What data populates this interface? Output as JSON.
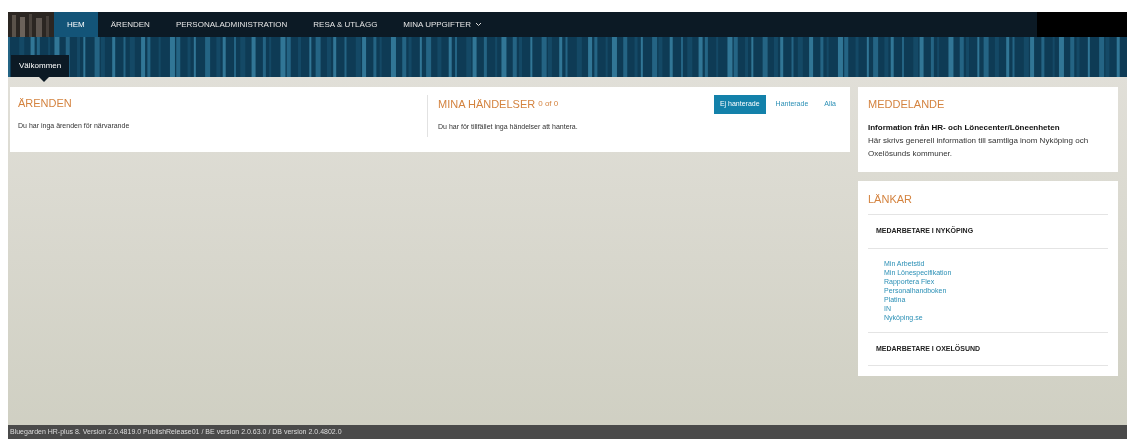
{
  "nav": {
    "items": [
      {
        "label": "HEM",
        "selected": true,
        "dropdown": false
      },
      {
        "label": "ÄRENDEN",
        "selected": false,
        "dropdown": false
      },
      {
        "label": "PERSONALADMINISTRATION",
        "selected": false,
        "dropdown": false
      },
      {
        "label": "RESA & UTLÄGG",
        "selected": false,
        "dropdown": false
      },
      {
        "label": "MINA UPPGIFTER",
        "selected": false,
        "dropdown": true
      }
    ]
  },
  "banner": {
    "tab": "Välkommen"
  },
  "arenden": {
    "title": "ÄRENDEN",
    "text": "Du har inga ärenden för närvarande"
  },
  "handelser": {
    "title": "MINA HÄNDELSER",
    "count": "0 of 0",
    "text": "Du har för tillfället inga händelser att hantera.",
    "filters": [
      {
        "label": "Ej hanterade",
        "selected": true
      },
      {
        "label": "Hanterade",
        "selected": false
      },
      {
        "label": "Alla",
        "selected": false
      }
    ]
  },
  "meddelande": {
    "title": "MEDDELANDE",
    "heading": "Information från HR- och Lönecenter/Löneenheten",
    "text": "Här skrivs generell information till samtliga inom Nyköping och Oxelösunds kommuner."
  },
  "lankar": {
    "title": "LÄNKAR",
    "groups": [
      {
        "title": "MEDARBETARE I NYKÖPING",
        "links": [
          "Min Arbetstid",
          "Min Lönespecifikation",
          "Rapportera Flex",
          "Personalhandboken",
          "Platina",
          "IN",
          "Nyköping.se"
        ]
      },
      {
        "title": "MEDARBETARE I OXELÖSUND"
      }
    ]
  },
  "footer": "Bluegarden HR-plus 8. Version 2.0.4819.0 PublishRelease01 / BE version 2.0.63.0 / DB version 2.0.4802.0"
}
